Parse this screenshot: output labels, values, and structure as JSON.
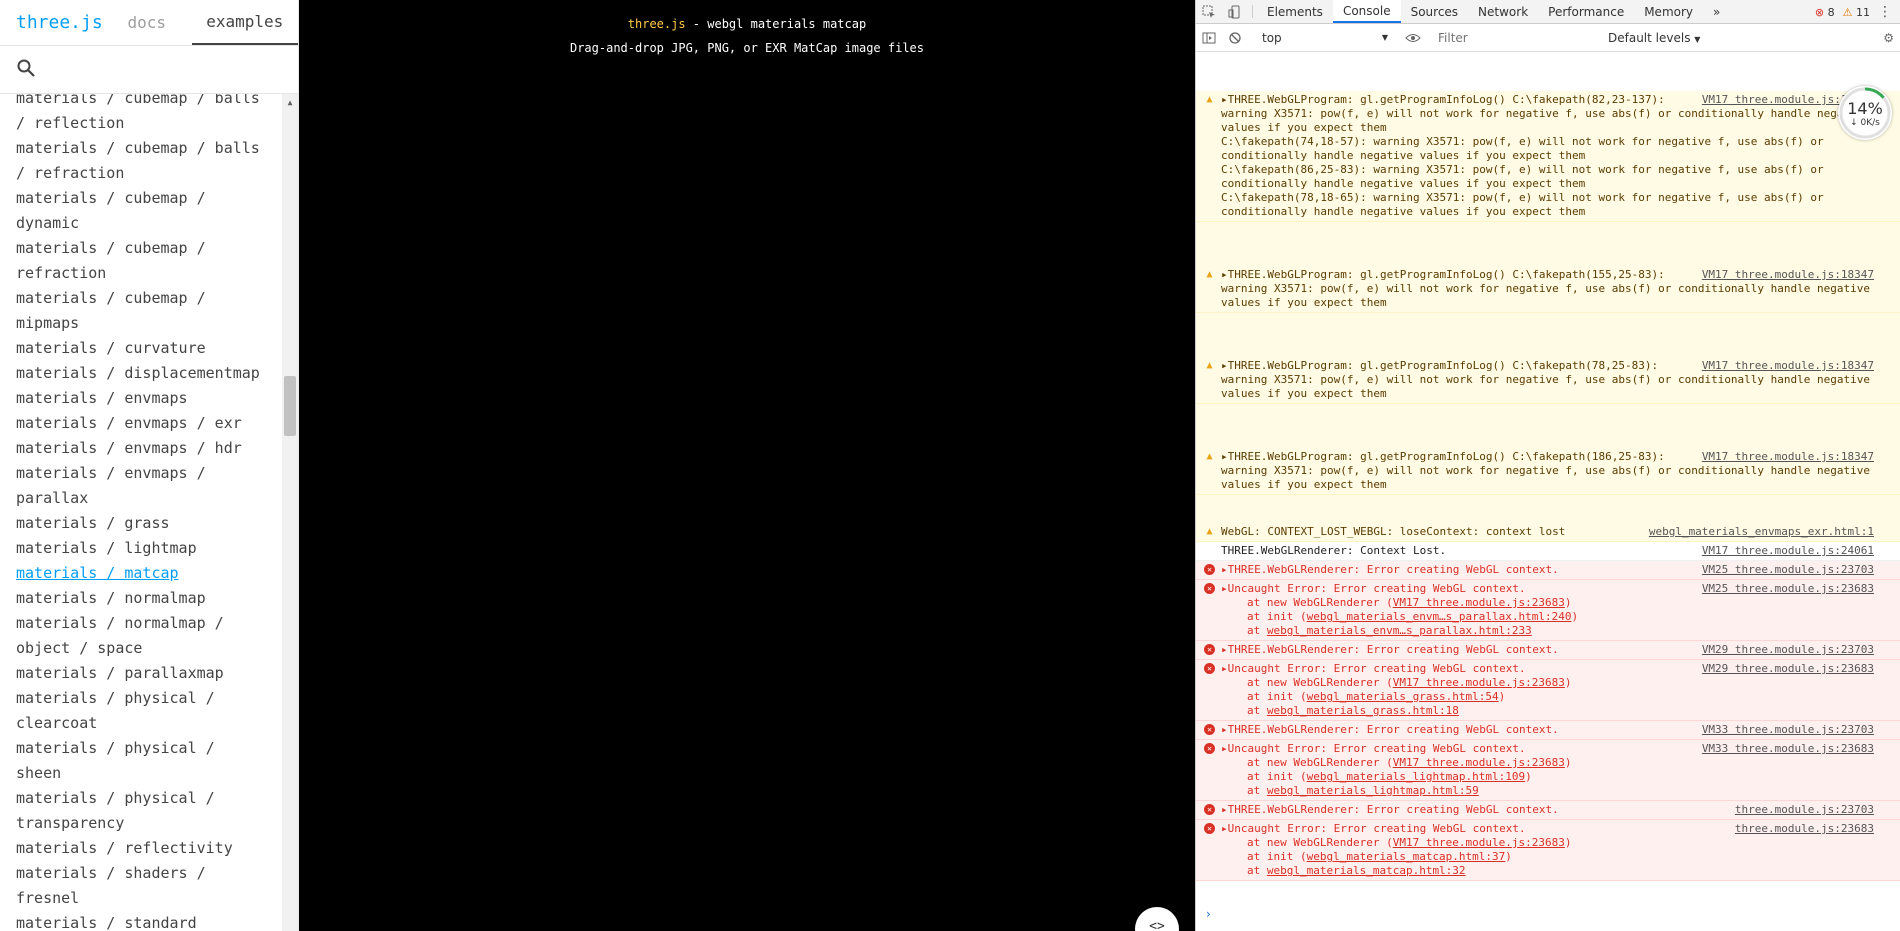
{
  "left": {
    "brand": "three.js",
    "tabs": {
      "docs": "docs",
      "examples": "examples"
    },
    "items": [
      "materials / cubemap / balls",
      "/ reflection",
      "materials / cubemap / balls\n/ refraction",
      "materials / cubemap /\ndynamic",
      "materials / cubemap /\nrefraction",
      "materials / cubemap /\nmipmaps",
      "materials / curvature",
      "materials / displacementmap",
      "materials / envmaps",
      "materials / envmaps / exr",
      "materials / envmaps / hdr",
      "materials / envmaps /\nparallax",
      "materials / grass",
      "materials / lightmap",
      "materials / matcap",
      "materials / normalmap",
      "materials / normalmap /\nobject / space",
      "materials / parallaxmap",
      "materials / physical /\nclearcoat",
      "materials / physical /\nsheen",
      "materials / physical /\ntransparency",
      "materials / reflectivity",
      "materials / shaders /\nfresnel",
      "materials / standard"
    ],
    "selected_index": 14
  },
  "viewport": {
    "info_link": "three.js",
    "info_rest": " - webgl materials matcap",
    "info_line2": "Drag-and-drop JPG, PNG, or EXR MatCap image files",
    "source_button": "<>"
  },
  "devtools": {
    "tabs": [
      "Elements",
      "Console",
      "Sources",
      "Network",
      "Performance",
      "Memory"
    ],
    "active_tab": "Console",
    "more": "»",
    "error_count": "8",
    "warning_count": "11",
    "context": "top",
    "filter_placeholder": "Filter",
    "levels": "Default levels",
    "gauge": {
      "percent": "14%",
      "speed": "↓ 0K/s",
      "fraction": 0.14
    },
    "messages": [
      {
        "type": "warn",
        "text": "▸THREE.WebGLProgram: gl.getProgramInfoLog() C:\\fakepath(82,23-137):\nwarning X3571: pow(f, e) will not work for negative f, use abs(f) or conditionally handle negative\nvalues if you expect them\nC:\\fakepath(74,18-57): warning X3571: pow(f, e) will not work for negative f, use abs(f) or\nconditionally handle negative values if you expect them\nC:\\fakepath(86,25-83): warning X3571: pow(f, e) will not work for negative f, use abs(f) or\nconditionally handle negative values if you expect them\nC:\\fakepath(78,18-65): warning X3571: pow(f, e) will not work for negative f, use abs(f) or\nconditionally handle negative values if you expect them",
        "src": "VM17 three.module.js:18347"
      },
      {
        "type": "warn",
        "text": "▸THREE.WebGLProgram: gl.getProgramInfoLog() C:\\fakepath(155,25-83):\nwarning X3571: pow(f, e) will not work for negative f, use abs(f) or conditionally handle negative\nvalues if you expect them",
        "src": "VM17 three.module.js:18347"
      },
      {
        "type": "warn",
        "text": "▸THREE.WebGLProgram: gl.getProgramInfoLog() C:\\fakepath(78,25-83):\nwarning X3571: pow(f, e) will not work for negative f, use abs(f) or conditionally handle negative\nvalues if you expect them",
        "src": "VM17 three.module.js:18347"
      },
      {
        "type": "warn",
        "text": "▸THREE.WebGLProgram: gl.getProgramInfoLog() C:\\fakepath(186,25-83):\nwarning X3571: pow(f, e) will not work for negative f, use abs(f) or conditionally handle negative\nvalues if you expect them",
        "src": "VM17 three.module.js:18347"
      },
      {
        "type": "warn",
        "text": "WebGL: CONTEXT_LOST_WEBGL: loseContext: context lost",
        "src": "webgl_materials_envmaps_exr.html:1"
      },
      {
        "type": "log",
        "text": "THREE.WebGLRenderer: Context Lost.",
        "src": "VM17 three.module.js:24061"
      },
      {
        "type": "err",
        "text": "▸THREE.WebGLRenderer: Error creating WebGL context.",
        "src": "VM25 three.module.js:23703"
      },
      {
        "type": "err",
        "text": "▸Uncaught Error: Error creating WebGL context.",
        "src": "VM25 three.module.js:23683",
        "stack": [
          {
            "pre": "at new WebGLRenderer (",
            "link": "VM17 three.module.js:23683",
            "post": ")"
          },
          {
            "pre": "at init (",
            "link": "webgl_materials_envm…s_parallax.html:240",
            "post": ")"
          },
          {
            "pre": "at ",
            "link": "webgl_materials_envm…s_parallax.html:233",
            "post": ""
          }
        ]
      },
      {
        "type": "err",
        "text": "▸THREE.WebGLRenderer: Error creating WebGL context.",
        "src": "VM29 three.module.js:23703"
      },
      {
        "type": "err",
        "text": "▸Uncaught Error: Error creating WebGL context.",
        "src": "VM29 three.module.js:23683",
        "stack": [
          {
            "pre": "at new WebGLRenderer (",
            "link": "VM17 three.module.js:23683",
            "post": ")"
          },
          {
            "pre": "at init (",
            "link": "webgl_materials_grass.html:54",
            "post": ")"
          },
          {
            "pre": "at ",
            "link": "webgl_materials_grass.html:18",
            "post": ""
          }
        ]
      },
      {
        "type": "err",
        "text": "▸THREE.WebGLRenderer: Error creating WebGL context.",
        "src": "VM33 three.module.js:23703"
      },
      {
        "type": "err",
        "text": "▸Uncaught Error: Error creating WebGL context.",
        "src": "VM33 three.module.js:23683",
        "stack": [
          {
            "pre": "at new WebGLRenderer (",
            "link": "VM17 three.module.js:23683",
            "post": ")"
          },
          {
            "pre": "at init (",
            "link": "webgl_materials_lightmap.html:109",
            "post": ")"
          },
          {
            "pre": "at ",
            "link": "webgl_materials_lightmap.html:59",
            "post": ""
          }
        ]
      },
      {
        "type": "err",
        "text": "▸THREE.WebGLRenderer: Error creating WebGL context.",
        "src": "three.module.js:23703"
      },
      {
        "type": "err",
        "text": "▸Uncaught Error: Error creating WebGL context.",
        "src": "three.module.js:23683",
        "stack": [
          {
            "pre": "at new WebGLRenderer (",
            "link": "VM17 three.module.js:23683",
            "post": ")"
          },
          {
            "pre": "at init (",
            "link": "webgl_materials_matcap.html:37",
            "post": ")"
          },
          {
            "pre": "at ",
            "link": "webgl_materials_matcap.html:32",
            "post": ""
          }
        ]
      }
    ],
    "prompt": "›"
  }
}
